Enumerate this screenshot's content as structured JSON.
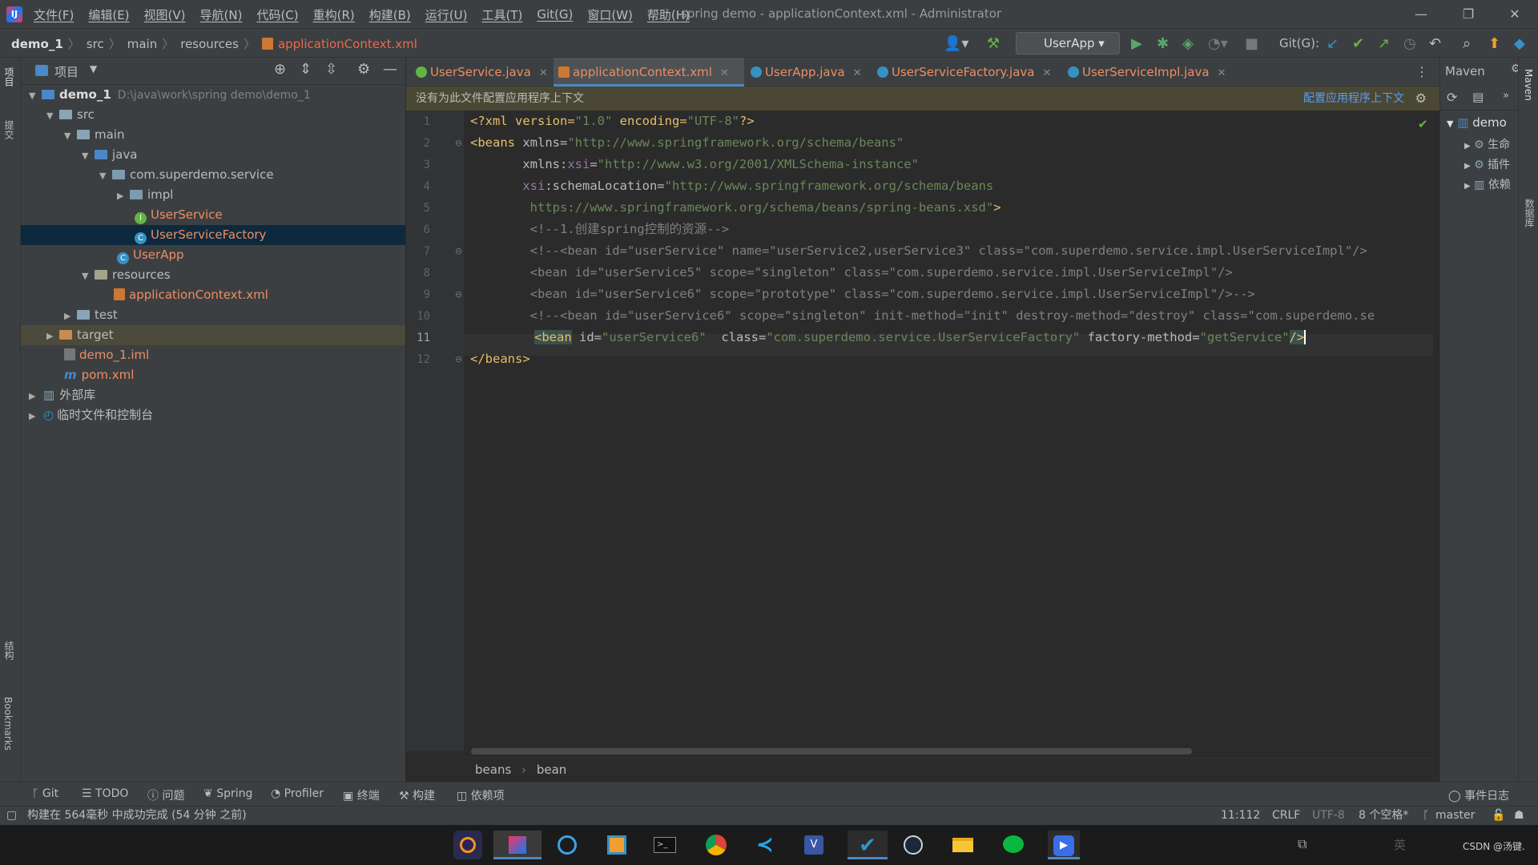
{
  "window": {
    "title": "spring demo - applicationContext.xml - Administrator",
    "menu": [
      "文件(F)",
      "编辑(E)",
      "视图(V)",
      "导航(N)",
      "代码(C)",
      "重构(R)",
      "构建(B)",
      "运行(U)",
      "工具(T)",
      "Git(G)",
      "窗口(W)",
      "帮助(H)"
    ]
  },
  "breadcrumb": [
    "demo_1",
    "src",
    "main",
    "resources",
    "applicationContext.xml"
  ],
  "toolbar": {
    "run_config": "UserApp",
    "git_label": "Git(G):"
  },
  "project": {
    "header": "项目",
    "tree": [
      {
        "label": "demo_1",
        "extra": "D:\\java\\work\\spring demo\\demo_1"
      },
      {
        "label": "src"
      },
      {
        "label": "main"
      },
      {
        "label": "java"
      },
      {
        "label": "com.superdemo.service"
      },
      {
        "label": "impl"
      },
      {
        "label": "UserService"
      },
      {
        "label": "UserServiceFactory"
      },
      {
        "label": "UserApp"
      },
      {
        "label": "resources"
      },
      {
        "label": "applicationContext.xml"
      },
      {
        "label": "test"
      },
      {
        "label": "target"
      },
      {
        "label": "demo_1.iml"
      },
      {
        "label": "pom.xml"
      },
      {
        "label": "外部库"
      },
      {
        "label": "临时文件和控制台"
      }
    ]
  },
  "tabs": [
    "UserService.java",
    "applicationContext.xml",
    "UserApp.java",
    "UserServiceFactory.java",
    "UserServiceImpl.java"
  ],
  "banner": {
    "message": "没有为此文件配置应用程序上下文",
    "link": "配置应用程序上下文"
  },
  "code": {
    "line_numbers": [
      "1",
      "2",
      "3",
      "4",
      "5",
      "6",
      "7",
      "8",
      "9",
      "10",
      "11",
      "12"
    ],
    "l1": {
      "a": "<?xml version=",
      "b": "\"1.0\"",
      "c": " encoding=",
      "d": "\"UTF-8\"",
      "e": "?>"
    },
    "l2": {
      "a": "<beans",
      "b": " xmlns=",
      "c": "\"http://www.springframework.org/schema/beans\""
    },
    "l3": {
      "a": "       xmlns:",
      "b": "xsi",
      "c": "=",
      "d": "\"http://www.w3.org/2001/XMLSchema-instance\""
    },
    "l4": {
      "a": "       xsi",
      "b": ":schemaLocation=",
      "c": "\"http://www.springframework.org/schema/beans"
    },
    "l5": {
      "a": "        https://www.springframework.org/schema/beans/spring-beans.xsd\"",
      "b": ">"
    },
    "l6": "        <!--1.创建spring控制的资源-->",
    "l7": "        <!--<bean id=\"userService\" name=\"userService2,userService3\" class=\"com.superdemo.service.impl.UserServiceImpl\"/>",
    "l8": "        <bean id=\"userService5\" scope=\"singleton\" class=\"com.superdemo.service.impl.UserServiceImpl\"/>",
    "l9": "        <bean id=\"userService6\" scope=\"prototype\" class=\"com.superdemo.service.impl.UserServiceImpl\"/>-->",
    "l10": "        <!--<bean id=\"userService6\" scope=\"singleton\" init-method=\"init\" destroy-method=\"destroy\" class=\"com.superdemo.se",
    "l11": {
      "a": "<bean",
      "b": " id=",
      "c": "\"userService6\"",
      "d": "  class=",
      "e": "\"com.superdemo.service.UserServiceFactory\"",
      "f": " factory-method=",
      "g": "\"getService\"",
      "h": "/>"
    },
    "l12": "</beans>"
  },
  "editor_crumb": [
    "beans",
    "bean"
  ],
  "maven": {
    "title": "Maven",
    "root": "demo",
    "items": [
      "生命",
      "插件",
      "依赖"
    ]
  },
  "bottom_tabs": [
    "Git",
    "TODO",
    "问题",
    "Spring",
    "Profiler",
    "终端",
    "构建",
    "依赖项"
  ],
  "event_log": "事件日志",
  "status": {
    "message": "构建在 564毫秒 中成功完成 (54 分钟 之前)",
    "position": "11:112",
    "line_sep": "CRLF",
    "encoding": "UTF-8",
    "indent": "8 个空格*",
    "branch": "master"
  },
  "left_strip": [
    "项目",
    "提交",
    "结构",
    "Bookmarks"
  ],
  "right_strip": [
    "Maven",
    "数据库"
  ],
  "taskbar_brand": "CSDN @汤键."
}
